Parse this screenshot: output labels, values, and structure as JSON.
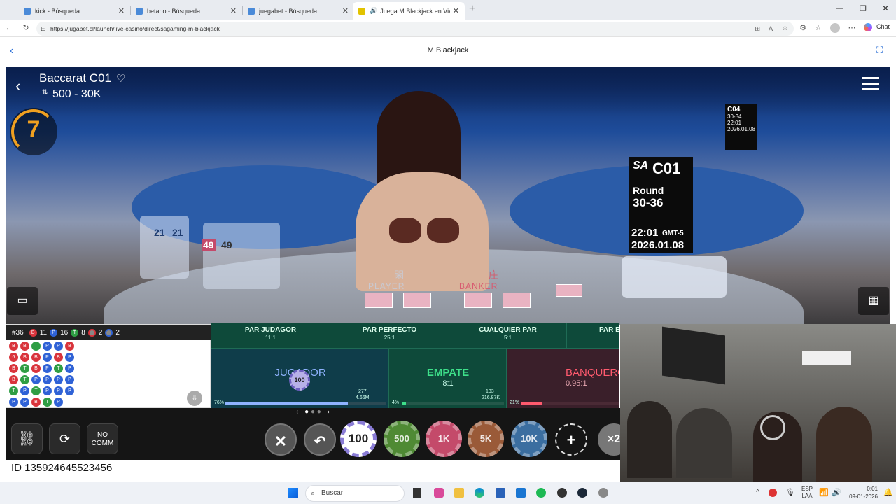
{
  "browser": {
    "tabs": [
      {
        "label": "kick - Búsqueda",
        "active": false
      },
      {
        "label": "betano - Búsqueda",
        "active": false
      },
      {
        "label": "juegabet - Búsqueda",
        "active": false
      },
      {
        "label": "Juega M Blackjack en Vivo de",
        "active": true
      }
    ],
    "new_tab_label": "+",
    "url": "https://jugabet.cl/launch/live-casino/direct/sagaming-m-blackjack",
    "profile_label": "Chat"
  },
  "page": {
    "title": "M Blackjack",
    "back_icon": "chevron-left-icon",
    "fullscreen_icon": "fullscreen-icon"
  },
  "game": {
    "table_name": "Baccarat C01",
    "bet_limits": "500 - 30K",
    "countdown": "7",
    "overlay": {
      "brand": "SA",
      "table_code": "C01",
      "round_label": "Round",
      "round_value": "30-36",
      "time": "22:01",
      "timezone": "GMT-5",
      "date": "2026.01.08"
    },
    "bg_table_sign": {
      "table_code": "C04",
      "round": "30-34",
      "time": "22:01",
      "timezone": "GMT-5",
      "date": "2026.01.08"
    },
    "player_label": "PLAYER",
    "banker_label": "BANKER",
    "player_chinese": "閑",
    "banker_chinese": "庄",
    "shoe_counts": [
      "21",
      "21",
      "49",
      "49"
    ]
  },
  "roadmap": {
    "shoe_number": "#36",
    "stats": [
      {
        "letter": "B",
        "count": "11",
        "color": "#d9343c"
      },
      {
        "letter": "P",
        "count": "16",
        "color": "#2f62d6"
      },
      {
        "letter": "T",
        "count": "8",
        "color": "#2f9e44"
      },
      {
        "letter": "",
        "count": "2",
        "color": "#d9343c"
      },
      {
        "letter": "",
        "count": "2",
        "color": "#2f62d6"
      }
    ],
    "columns": [
      [
        "B",
        "6",
        "B",
        "B",
        "T",
        "P"
      ],
      [
        "B",
        "B",
        "T",
        "T",
        "P",
        "P"
      ],
      [
        "T",
        "B",
        "B",
        "P",
        "T",
        "B"
      ],
      [
        "P",
        "P",
        "P",
        "P",
        "P",
        "T"
      ],
      [
        "P",
        "B",
        "T",
        "P",
        "P",
        "P"
      ],
      [
        "B",
        "P",
        "P",
        "P",
        "P",
        ""
      ]
    ]
  },
  "board": {
    "side_bets": [
      {
        "name": "PAR JUDAGOR",
        "odds": "11:1"
      },
      {
        "name": "PAR PERFECTO",
        "odds": "25:1"
      },
      {
        "name": "CUALQUIER PAR",
        "odds": "5:1"
      },
      {
        "name": "PAR BA",
        "odds": ""
      }
    ],
    "main_bets": [
      {
        "name": "JUGADOR",
        "odds": "",
        "pct": "76%",
        "players": "277",
        "amount": "4.66M",
        "color": "#8fb3ff"
      },
      {
        "name": "EMPATE",
        "odds": "8:1",
        "pct": "4%",
        "players": "133",
        "amount": "216.87K",
        "color": "#3ee08a"
      },
      {
        "name": "BANQUERO",
        "odds": "0.95:1",
        "pct": "21%",
        "players": "",
        "amount": "",
        "color": "#ff5a6e"
      }
    ],
    "placed_chip": "100",
    "pagination_prev": "‹",
    "pagination_next": "›"
  },
  "controls": {
    "no_comm_label": "NO COMM",
    "chips": [
      {
        "label": "100",
        "color": "#8a7cd6",
        "selected": true
      },
      {
        "label": "500",
        "color": "#4f8a34",
        "selected": false
      },
      {
        "label": "1K",
        "color": "#c44a6a",
        "selected": false
      },
      {
        "label": "5K",
        "color": "#9a5a38",
        "selected": false
      },
      {
        "label": "10K",
        "color": "#3b6ea0",
        "selected": false
      }
    ],
    "multiplier_label": "×2",
    "round_id": "ID 135924645523456"
  },
  "taskbar": {
    "search_placeholder": "Buscar",
    "lang": "ESP",
    "lang2": "LAA",
    "time": "0:01",
    "date": "09-01-2026"
  }
}
